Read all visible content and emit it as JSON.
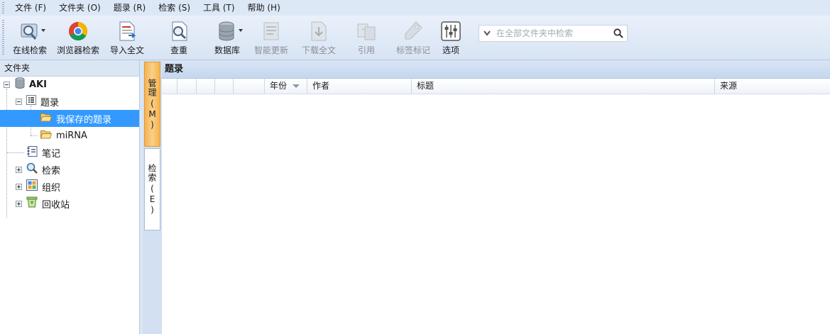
{
  "menu": [
    "文件 (F)",
    "文件夹 (O)",
    "题录 (R)",
    "检索 (S)",
    "工具 (T)",
    "帮助 (H)"
  ],
  "toolbar": [
    {
      "label": "在线检索",
      "icon": "online-search-icon",
      "enabled": true,
      "has_dropdown": true
    },
    {
      "label": "浏览器检索",
      "icon": "browser-icon",
      "enabled": true,
      "has_dropdown": false
    },
    {
      "label": "导入全文",
      "icon": "import-pdf-icon",
      "enabled": true,
      "has_dropdown": false
    },
    {
      "label": "查重",
      "icon": "duplicate-check-icon",
      "enabled": true,
      "has_dropdown": false
    },
    {
      "label": "数据库",
      "icon": "database-icon",
      "enabled": true,
      "has_dropdown": true
    },
    {
      "label": "智能更新",
      "icon": "smart-update-icon",
      "enabled": false,
      "has_dropdown": false
    },
    {
      "label": "下载全文",
      "icon": "download-fulltext-icon",
      "enabled": false,
      "has_dropdown": false
    },
    {
      "label": "引用",
      "icon": "cite-icon",
      "enabled": false,
      "has_dropdown": false
    },
    {
      "label": "标签标记",
      "icon": "tag-icon",
      "enabled": false,
      "has_dropdown": false
    },
    {
      "label": "选项",
      "icon": "options-icon",
      "enabled": true,
      "has_dropdown": false
    }
  ],
  "search": {
    "placeholder": "在全部文件夹中检索",
    "value": ""
  },
  "left_panel": {
    "title": "文件夹",
    "tree": [
      {
        "label": "AKI",
        "icon": "database-icon",
        "level": 0,
        "expanded": true
      },
      {
        "label": "题录",
        "icon": "list-icon",
        "level": 1,
        "expanded": true
      },
      {
        "label": "我保存的题录",
        "icon": "folder-open-icon",
        "level": 2,
        "selected": true
      },
      {
        "label": "miRNA",
        "icon": "folder-icon",
        "level": 2
      },
      {
        "label": "笔记",
        "icon": "notebook-icon",
        "level": 1
      },
      {
        "label": "检索",
        "icon": "search-icon",
        "level": 1,
        "expanded": false
      },
      {
        "label": "组织",
        "icon": "organize-icon",
        "level": 1,
        "expanded": false
      },
      {
        "label": "回收站",
        "icon": "recycle-bin-icon",
        "level": 1,
        "expanded": false
      }
    ]
  },
  "vertical_tabs": [
    {
      "label": "管理",
      "key": "M",
      "active": true
    },
    {
      "label": "检索",
      "key": "E",
      "active": false
    }
  ],
  "right_panel": {
    "title": "题录",
    "columns": [
      "",
      "",
      "",
      "",
      "",
      "年份",
      "作者",
      "标题",
      "来源"
    ],
    "sorted_column": "年份",
    "rows": []
  },
  "colors": {
    "selection": "#3399ff",
    "active_tab": "#f9b24f",
    "toolbar_bg": "#dde8f6"
  }
}
